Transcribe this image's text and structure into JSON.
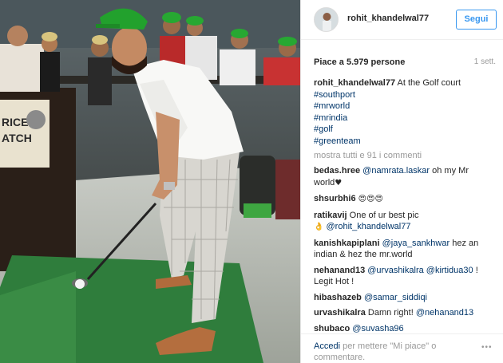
{
  "post": {
    "username": "rohit_khandelwal77",
    "follow_label": "Segui",
    "likes_label": "Piace a 5.979 persone",
    "time_label": "1 sett."
  },
  "caption": {
    "username": "rohit_khandelwal77",
    "text": "At the Golf court",
    "hashtags": [
      "#southport",
      "#mrworld",
      "#mrindia",
      "#golf",
      "#greenteam"
    ]
  },
  "show_all_comments": "mostra tutti e 91 i commenti",
  "comments": [
    {
      "user": "bedas.hree",
      "mention": "@namrata.laskar",
      "text": "oh my Mr world",
      "emoji": "♥"
    },
    {
      "user": "shsurbhi6",
      "text": "",
      "emoji": "😍😍😍"
    },
    {
      "user": "ratikavij",
      "text": "One of ur best pic",
      "emoji": "👌",
      "mention": "@rohit_khandelwal77"
    },
    {
      "user": "kanishkapiplani",
      "mention": "@jaya_sankhwar",
      "text": "hez an indian & hez the mr.world"
    },
    {
      "user": "nehanand13",
      "mention": "@urvashikalra",
      "mention2": "@kirtidua30",
      "text": "! Legit Hot !"
    },
    {
      "user": "hibashazeb",
      "mention": "@samar_siddiqi"
    },
    {
      "user": "urvashikalra",
      "text": "Damn right!",
      "mention": "@nehanand13"
    },
    {
      "user": "shubaco",
      "mention": "@suvasha96"
    }
  ],
  "footer": {
    "login_link": "Accedi",
    "login_text": "per mettere \"Mi piace\" o commentare.",
    "more_icon": "•••"
  },
  "photo": {
    "banner_text_1": "RICE",
    "banner_text_2": "ATCH"
  }
}
